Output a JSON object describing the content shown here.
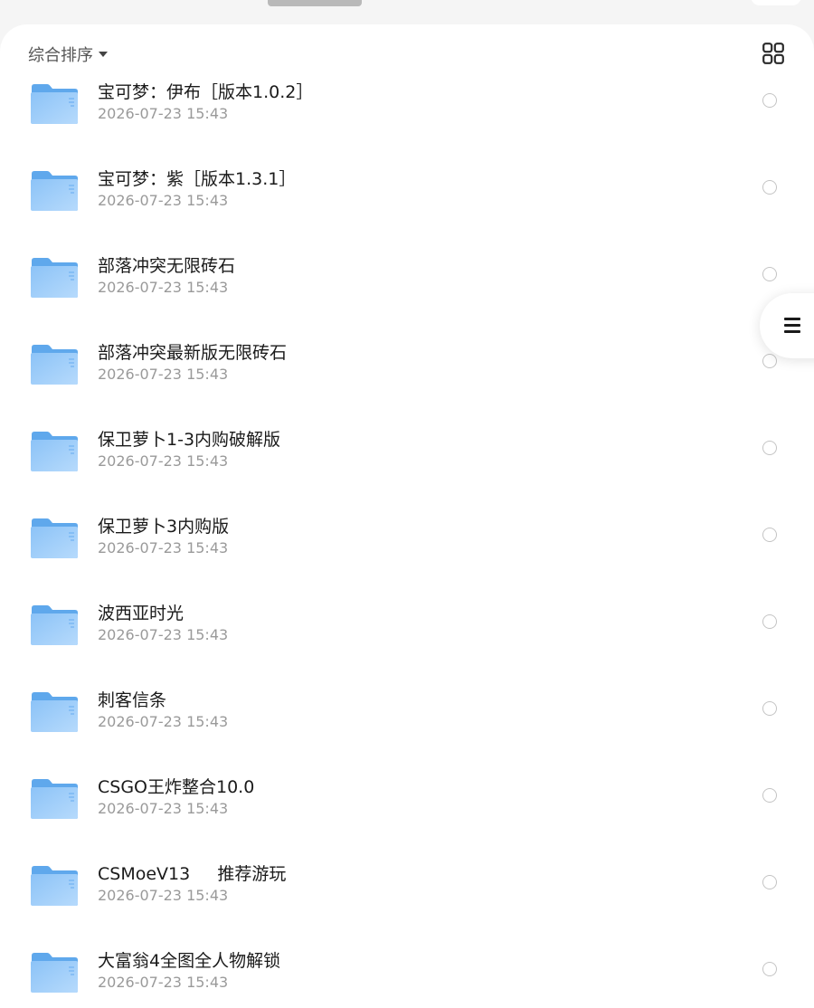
{
  "toolbar": {
    "sort_label": "综合排序",
    "sort_icon": "caret-down-icon",
    "view_toggle_icon": "grid-view-icon"
  },
  "side_tab": {
    "icon": "list-menu-icon"
  },
  "colors": {
    "folder_back": "#5fa8ec",
    "folder_front": "#a4d0fb",
    "name_text": "#1a1a1a",
    "date_text": "#9a9a9a",
    "radio_border": "#c4c4c4"
  },
  "files": [
    {
      "name": "宝可梦：伊布［版本1.0.2］",
      "date": "2026-07-23 15:43"
    },
    {
      "name": "宝可梦：紫［版本1.3.1］",
      "date": "2026-07-23 15:43"
    },
    {
      "name": "部落冲突无限砖石",
      "date": "2026-07-23 15:43"
    },
    {
      "name": "部落冲突最新版无限砖石",
      "date": "2026-07-23 15:43"
    },
    {
      "name": "保卫萝卜1-3内购破解版",
      "date": "2026-07-23 15:43"
    },
    {
      "name": "保卫萝卜3内购版",
      "date": "2026-07-23 15:43"
    },
    {
      "name": "波西亚时光",
      "date": "2026-07-23 15:43"
    },
    {
      "name": "刺客信条",
      "date": "2026-07-23 15:43"
    },
    {
      "name": "CSGO王炸整合10.0",
      "date": "2026-07-23 15:43"
    },
    {
      "name": "CSMoeV13     推荐游玩",
      "date": "2026-07-23 15:43"
    },
    {
      "name": "大富翁4全图全人物解锁",
      "date": "2026-07-23 15:43"
    }
  ]
}
